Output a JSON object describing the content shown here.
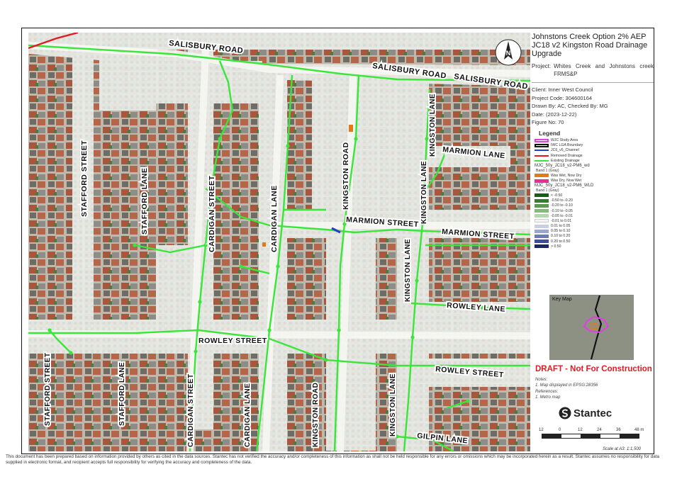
{
  "title": {
    "line1": "Johnstons Creek Option 2% AEP",
    "line2": "JC18 v2 Kingston Road Drainage",
    "line3": "Upgrade"
  },
  "project": {
    "label": "Project:",
    "value": "Whites Creek and Johnstons creek FRMS&P"
  },
  "info": {
    "client": "Client:  Inner West Council",
    "project_code": "Project Code:  304600164",
    "drawn_by": "Drawn By:  AC, Checked By: MG",
    "date": "Date:  (2023-12-22)",
    "figure_no": "Figure No:  70"
  },
  "legend": {
    "title": "Legend",
    "items": [
      {
        "label": "WJC Study Area",
        "kind": "box",
        "color": "#e040e0"
      },
      {
        "label": "IWC LGA Boundary",
        "kind": "box",
        "color": "#111111"
      },
      {
        "label": "JC6_v5_Channel",
        "kind": "line",
        "color": "#1f3bd1"
      },
      {
        "label": "Removed Drainage",
        "kind": "line",
        "color": "#e11b22"
      },
      {
        "label": "Existing Drainage",
        "kind": "line",
        "color": "#39e639"
      }
    ],
    "group1_title": "MJC_50y_JC18_v2-PM6_wd",
    "group1_band": "Band 1 (Gray)",
    "group1": [
      {
        "label": "Was Wet, Now Dry",
        "color": "#e07a1a"
      },
      {
        "label": "Was Dry, Now Wet",
        "color": "#e0309a"
      }
    ],
    "group2_title": "MJC_50y_JC18_v2-PM6_WLD",
    "group2_band": "Band 1 (Gray)",
    "group2": [
      {
        "label": "< -0.50",
        "color": "#1e5a1e"
      },
      {
        "label": "-0.50 to -0.20",
        "color": "#3c7a34"
      },
      {
        "label": "-0.20 to -0.10",
        "color": "#5d9a52"
      },
      {
        "label": "-0.10 to -0.05",
        "color": "#86b97d"
      },
      {
        "label": "-0.05 to -0.01",
        "color": "#b5d7ad"
      },
      {
        "label": "-0.01 to 0.01",
        "color": "#f4f4f4"
      },
      {
        "label": "0.01 to 0.05",
        "color": "#c9cfe2"
      },
      {
        "label": "0.05 to 0.10",
        "color": "#9aa6cc"
      },
      {
        "label": "0.10 to 0.20",
        "color": "#6b7cb3"
      },
      {
        "label": "0.20 to 0.50",
        "color": "#3f4f94"
      },
      {
        "label": "> 0.50",
        "color": "#1c2566"
      }
    ]
  },
  "keymap": {
    "label": "Key Map"
  },
  "draft": "DRAFT - Not For Construction",
  "notes": {
    "heading": "Notes:",
    "note1": "1. Map displayed in EPSG:28356",
    "ref_heading": "References:",
    "ref1": "1. Metro map"
  },
  "brand": "Stantec",
  "scalebar": {
    "ticks": [
      "12",
      "0",
      "12",
      "24",
      "36",
      "48 m"
    ],
    "scale_text": "Scale at A3: 1:1,500"
  },
  "north": "N",
  "streets": {
    "salisbury_road": "SALISBURY ROAD",
    "stafford_street": "STAFFORD STREET",
    "stafford_lane": "STAFFORD LANE",
    "cardigan_street": "CARDIGAN STREET",
    "cardigan_lane": "CARDIGAN LANE",
    "kingston_road": "KINGSTON ROAD",
    "kingston_lane": "KINGSTON LANE",
    "marmion_lane": "MARMION LANE",
    "marmion_street": "MARMION STREET",
    "rowley_lane": "ROWLEY LANE",
    "rowley_street": "ROWLEY STREET",
    "gilpin_lane": "GILPIN LANE"
  },
  "footer": "This document has been prepared based on information provided by others as cited in the data sources. Stantec has not verified the accuracy and/or completeness of this information as shall not be held responsible for any errors or omissions which may be incorporated herein as a result. Stantec assumes no responsibility for data supplied in electronic format, and recipient accepts full responsibility for verifying the accuracy and completeness of the data."
}
